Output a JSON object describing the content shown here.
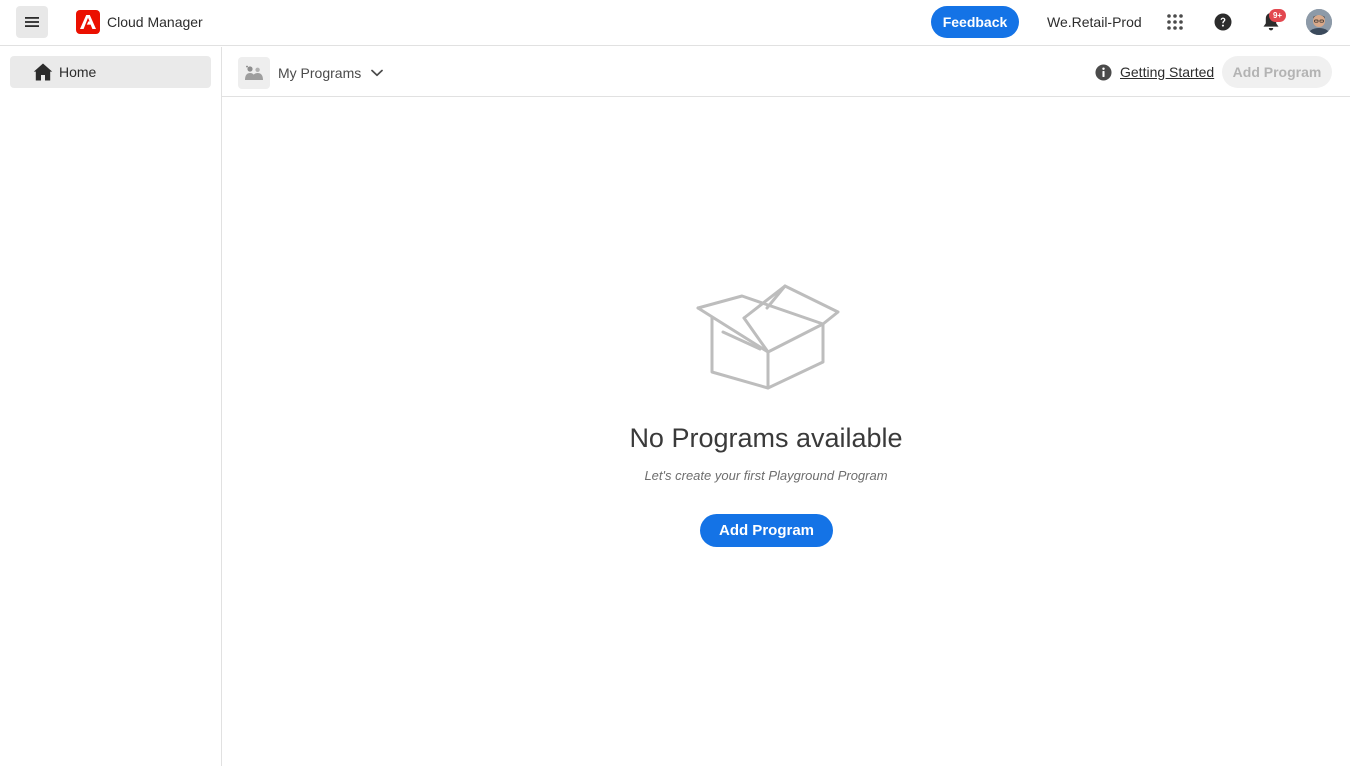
{
  "header": {
    "app_title": "Cloud Manager",
    "feedback_label": "Feedback",
    "org_name": "We.Retail-Prod",
    "notification_badge": "9+",
    "icons": [
      "menu-icon",
      "adobe-logo",
      "apps-grid-icon",
      "help-icon",
      "bell-icon",
      "avatar"
    ]
  },
  "sidebar": {
    "items": [
      {
        "label": "Home",
        "icon": "home-icon",
        "selected": true
      }
    ]
  },
  "subheader": {
    "program_selector_label": "My Programs",
    "getting_started_label": "Getting Started",
    "add_program_label": "Add Program"
  },
  "empty_state": {
    "title": "No Programs available",
    "subtitle": "Let's create your first Playground Program",
    "button_label": "Add Program",
    "illustration": "open-box"
  },
  "colors": {
    "accent": "#1473e6",
    "brand": "#eb1000",
    "badge": "#e34850"
  }
}
